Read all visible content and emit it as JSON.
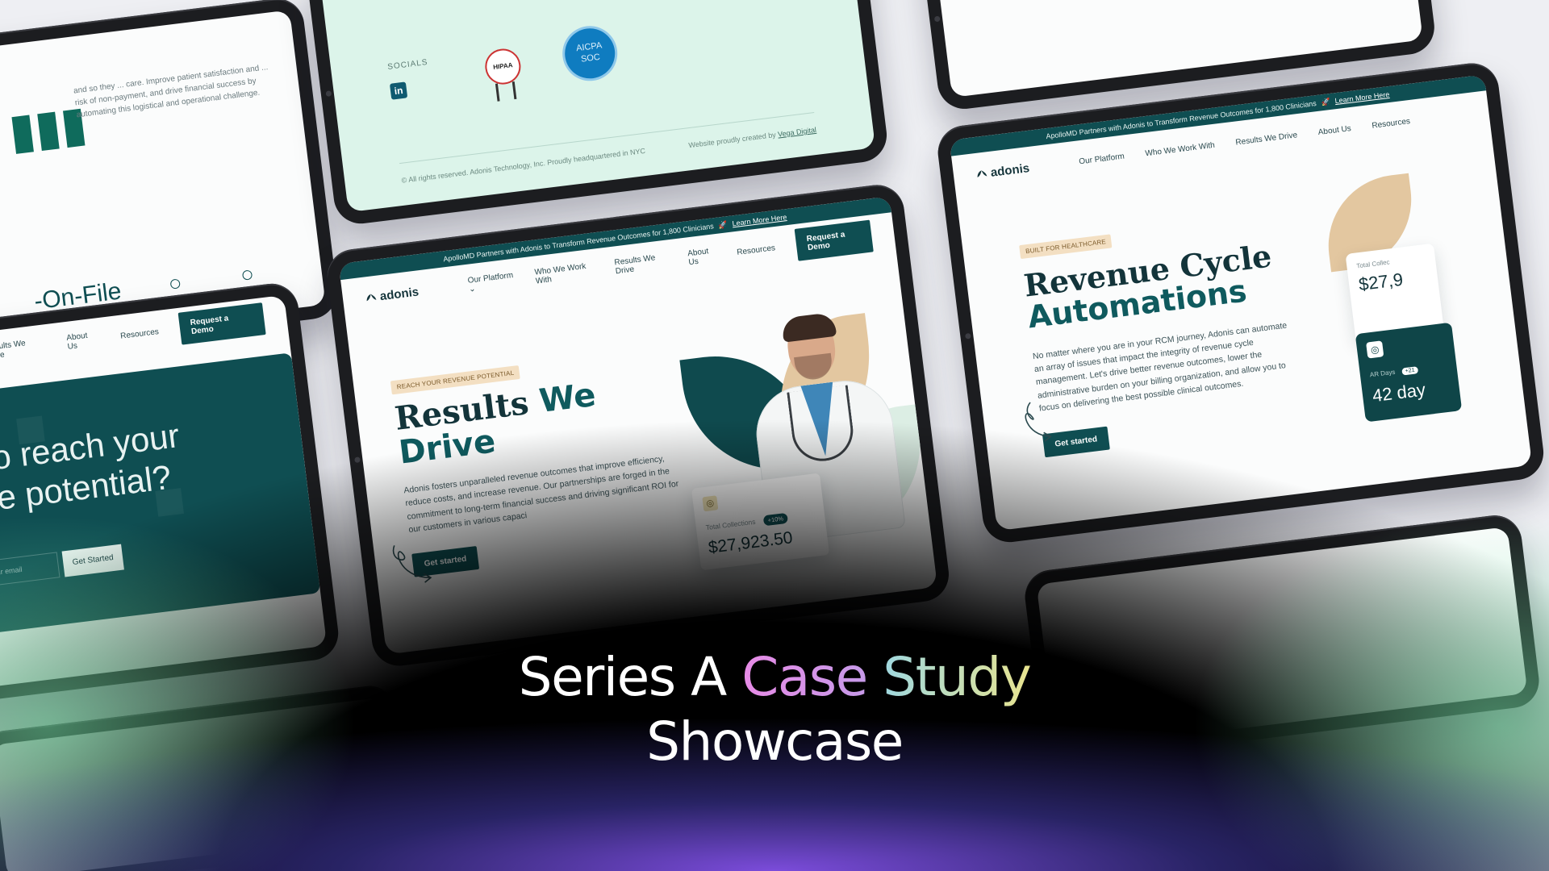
{
  "headline": {
    "line1_part1": "Series A ",
    "line1_case": "Case",
    "line1_space": " ",
    "line1_study": "Study",
    "line2": "Showcase"
  },
  "site": {
    "logo": "adonis",
    "announcement": "ApolloMD Partners with Adonis to Transform Revenue Outcomes for 1,800 Clinicians",
    "announcement_link": "Learn More Here",
    "nav": [
      "Our Platform",
      "Who We Work With",
      "Results We Drive",
      "About Us",
      "Resources"
    ],
    "demo_button": "Request a Demo"
  },
  "tablet_a": {
    "body_text": "and so they ... care. Improve patient satisfaction and ... risk of non-payment, and drive financial success by automating this logistical and operational challenge.",
    "tagline": "-On-File"
  },
  "tablet_b": {
    "socials_label": "SOCIALS",
    "linkedin": "in",
    "hipaa_badge": "HIPAA",
    "aicpa_badge_line1": "AICPA",
    "aicpa_badge_line2": "SOC",
    "copyright": "© All rights reserved. Adonis Technology, Inc. Proudly headquartered in NYC",
    "credit_prefix": "Website proudly created by ",
    "credit_link": "Vega Digital"
  },
  "tablet_d": {
    "pill": "REACH YOUR REVENUE POTENTIAL",
    "title_part1": "Results ",
    "title_part2": "We Drive",
    "body": "Adonis fosters unparalleled revenue outcomes that improve efficiency, reduce costs, and increase revenue. Our partnerships are forged in the commitment to long-term financial success and driving significant ROI for our customers in various capaci",
    "cta": "Get started",
    "stat_label": "Total Collections",
    "stat_delta": "+10%",
    "stat_value": "$27,923.50"
  },
  "tablet_e": {
    "cta_title_line1": "eady to reach your",
    "cta_title_line2": "evenue potential?",
    "email_placeholder": "Enter your email",
    "get_started": "Get Started"
  },
  "tablet_f": {
    "pill": "BUILT FOR HEALTHCARE",
    "title_line1": "Revenue Cycle",
    "title_line2": "Automations",
    "body": "No matter where you are in your RCM journey, Adonis can automate an array of issues that impact the integrity of revenue cycle management. Let's drive better revenue outcomes, lower the administrative burden on your billing organization, and allow you to focus on delivering the best possible clinical outcomes.",
    "cta": "Get started",
    "card1_label": "Total Collec",
    "card1_value": "$27,9",
    "card2_label": "AR Days",
    "card2_delta": "+21",
    "card2_value": "42 day"
  },
  "colors": {
    "brand_teal": "#0f4e52",
    "tan": "#e3c7a0",
    "mint": "#dcf4ea",
    "glow_purple": "#8250e6",
    "headline_pink": "#e78be6",
    "headline_yellow": "#e9e48f"
  }
}
